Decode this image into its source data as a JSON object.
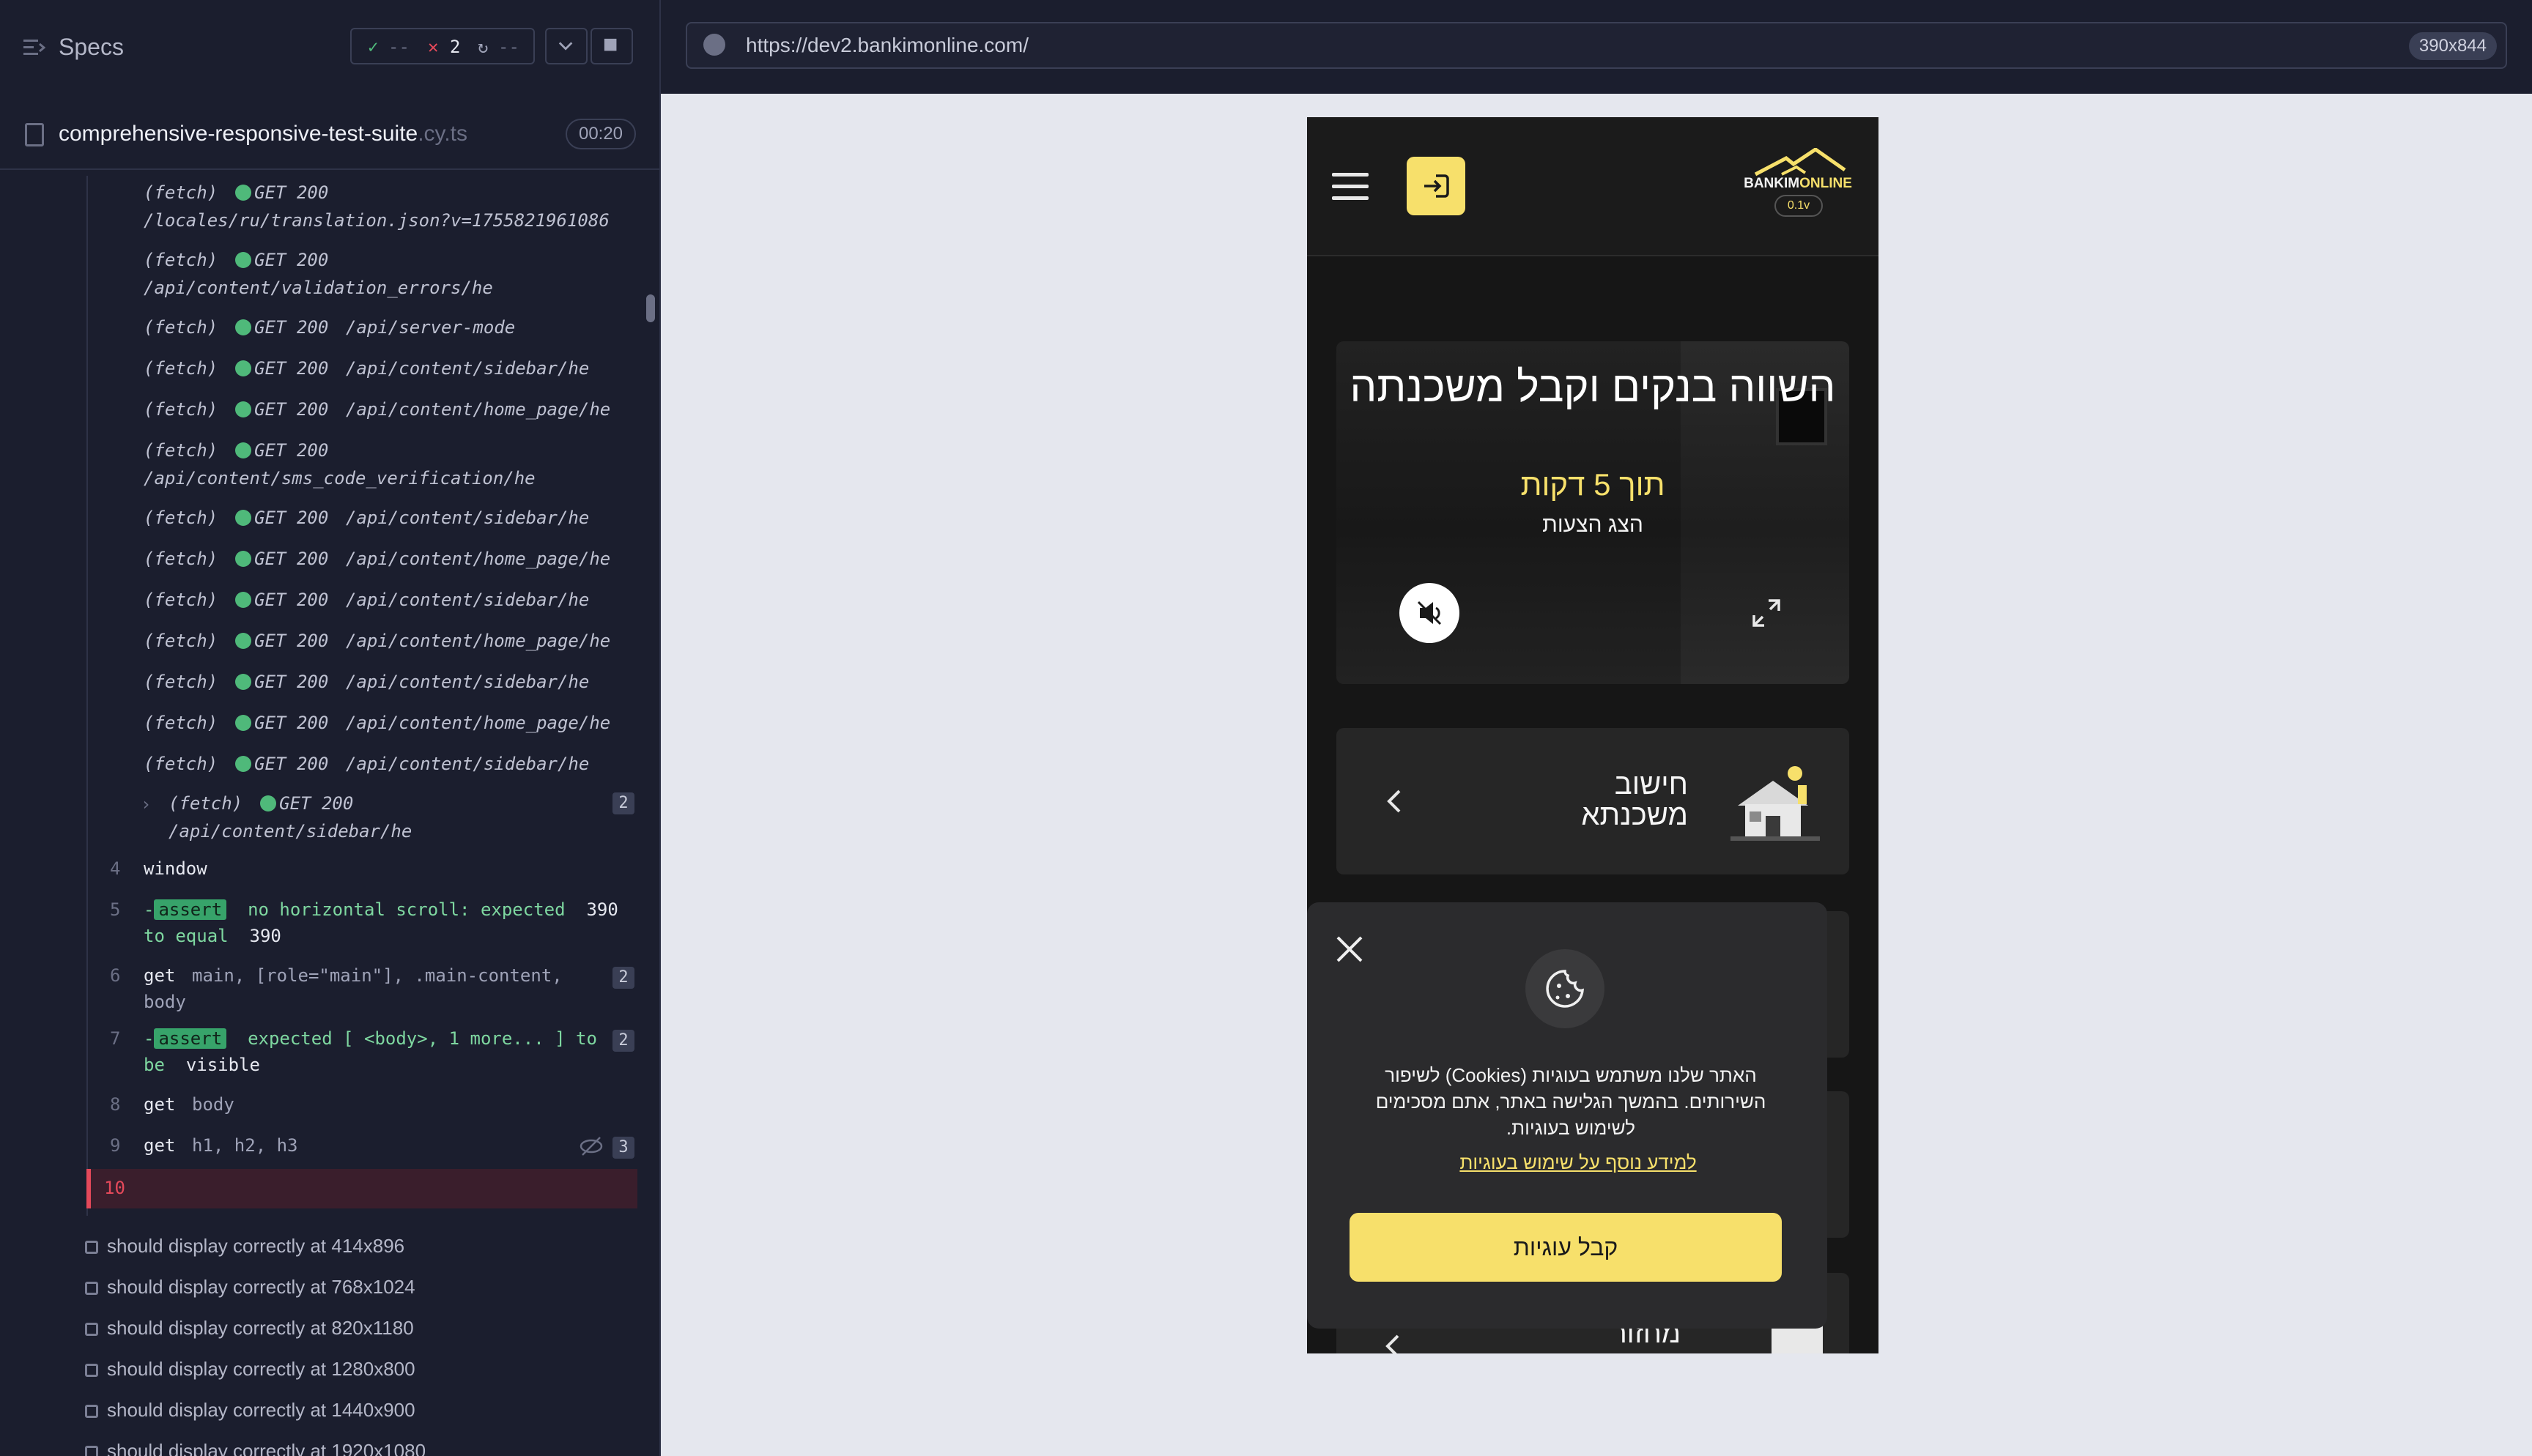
{
  "reporter": {
    "title": "Specs",
    "stats": {
      "passed": "--",
      "failed": "2",
      "pending": "--"
    },
    "spec_file": {
      "name": "comprehensive-responsive-test-suite",
      "ext": ".cy.ts",
      "duration": "00:20"
    },
    "fetch_commands": [
      {
        "type": "(fetch)",
        "method": "GET 200",
        "path": "/locales/ru/translation.json?v=1755821961086",
        "wrap": true
      },
      {
        "type": "(fetch)",
        "method": "GET 200",
        "path": "/api/content/validation_errors/he",
        "wrap": true
      },
      {
        "type": "(fetch)",
        "method": "GET 200",
        "path": "/api/server-mode",
        "wrap": false
      },
      {
        "type": "(fetch)",
        "method": "GET 200",
        "path": "/api/content/sidebar/he",
        "wrap": false
      },
      {
        "type": "(fetch)",
        "method": "GET 200",
        "path": "/api/content/home_page/he",
        "wrap": false
      },
      {
        "type": "(fetch)",
        "method": "GET 200",
        "path": "/api/content/sms_code_verification/he",
        "wrap": true
      },
      {
        "type": "(fetch)",
        "method": "GET 200",
        "path": "/api/content/sidebar/he",
        "wrap": false
      },
      {
        "type": "(fetch)",
        "method": "GET 200",
        "path": "/api/content/home_page/he",
        "wrap": false
      },
      {
        "type": "(fetch)",
        "method": "GET 200",
        "path": "/api/content/sidebar/he",
        "wrap": false
      },
      {
        "type": "(fetch)",
        "method": "GET 200",
        "path": "/api/content/home_page/he",
        "wrap": false
      },
      {
        "type": "(fetch)",
        "method": "GET 200",
        "path": "/api/content/sidebar/he",
        "wrap": false
      },
      {
        "type": "(fetch)",
        "method": "GET 200",
        "path": "/api/content/home_page/he",
        "wrap": false
      },
      {
        "type": "(fetch)",
        "method": "GET 200",
        "path": "/api/content/sidebar/he",
        "wrap": false
      }
    ],
    "grouped_fetch": {
      "type": "(fetch)",
      "method": "GET 200",
      "path": "/api/content/sidebar/he",
      "count": "2"
    },
    "steps": [
      {
        "num": "4",
        "cmd": "window",
        "arg": ""
      },
      {
        "num": "5",
        "tag": "assert",
        "text1": "no horizontal scroll: expected",
        "val1": "390",
        "text2": "to equal",
        "val2": "390"
      },
      {
        "num": "6",
        "cmd": "get",
        "arg": "main, [role=\"main\"], .main-content,",
        "arg2": "body",
        "count": "2"
      },
      {
        "num": "7",
        "tag": "assert",
        "text1": "expected [ <body>, 1 more... ] to",
        "text2": "be",
        "val2": "visible",
        "count": "2"
      },
      {
        "num": "8",
        "cmd": "get",
        "arg": "body"
      },
      {
        "num": "9",
        "cmd": "get",
        "arg": "h1, h2, h3",
        "count": "3"
      },
      {
        "num": "10"
      }
    ],
    "tests": [
      "should display correctly at 414x896",
      "should display correctly at 768x1024",
      "should display correctly at 820x1180",
      "should display correctly at 1280x800",
      "should display correctly at 1440x900",
      "should display correctly at 1920x1080"
    ]
  },
  "browser": {
    "url": "https://dev2.bankimonline.com/",
    "viewport": "390x844"
  },
  "app": {
    "logo": {
      "part1": "BANKIM",
      "part2": "ONLINE",
      "version": "0.1v"
    },
    "hero": {
      "title": "השווה בנקים וקבל משכנתה",
      "subtitle": "תוך 5 דקות",
      "small": "הצג הצעות"
    },
    "cards": [
      {
        "title": "חישוב משכנתא"
      }
    ],
    "bottom_card_title": "מחזור",
    "cookie": {
      "text": "האתר שלנו משתמש בעוגיות (Cookies) לשיפור השירותים. בהמשך הגלישה באתר, אתם מסכימים לשימוש בעוגיות.",
      "link": "למידע נוסף על שימוש בעוגיות",
      "accept": "קבל עוגיות"
    },
    "colors": {
      "accent": "#f7e06b",
      "background": "#161616",
      "card": "#262626"
    }
  }
}
